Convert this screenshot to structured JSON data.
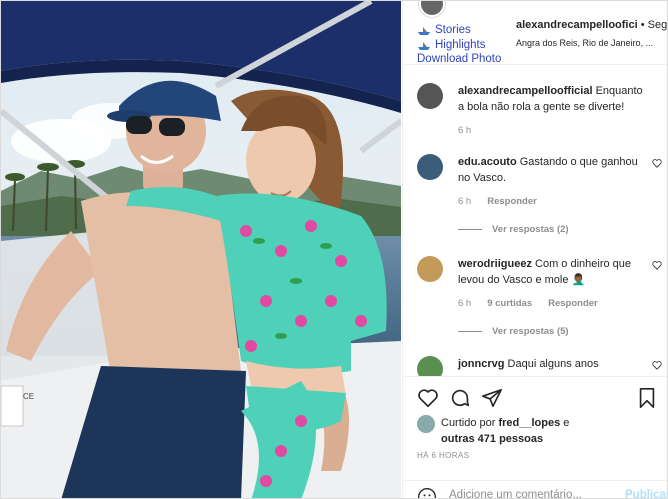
{
  "post": {
    "photo_alt": "",
    "username": "alexandrecampelloofici",
    "follow_sep": " • Seg",
    "location": "Angra dos Reis, Rio de Janeiro, ...",
    "download_links": {
      "stories": "Stories",
      "highlights": "Highlights",
      "download_photo": "Download Photo"
    }
  },
  "comments": [
    {
      "user": "alexandrecampelloofficial",
      "text": "Enquanto a bola não rola a gente se diverte!",
      "time": "6 h",
      "likes": "",
      "reply": "",
      "view_replies": "",
      "avatar_color": "#555555"
    },
    {
      "user": "edu.acouto",
      "text": "Gastando o que ganhou no Vasco.",
      "time": "6 h",
      "likes": "",
      "reply": "Responder",
      "view_replies": "Ver respostas (2)",
      "avatar_color": "#3b5d7a"
    },
    {
      "user": "werodriigueez",
      "text": "Com o dinheiro que levou do Vasco e mole 🤦🏾‍♂️",
      "time": "6 h",
      "likes": "9 curtidas",
      "reply": "Responder",
      "view_replies": "Ver respostas (5)",
      "avatar_color": "#c49a5a"
    },
    {
      "user": "jonncrvg",
      "text": "Daqui alguns anos",
      "time": "",
      "likes": "",
      "reply": "",
      "view_replies": "",
      "avatar_color": "#5b8f52"
    }
  ],
  "liked_by": {
    "prefix": "Curtido por ",
    "user": "fred__lopes",
    "mid": " e",
    "others": "outras 471 pessoas"
  },
  "timestamp": "HÁ 6 HORAS",
  "add_comment": {
    "placeholder": "Adicione um comentário...",
    "publish": "Publicar"
  },
  "icons": [
    "heart-icon",
    "comment-icon",
    "share-icon",
    "bookmark-icon",
    "emoji-icon",
    "boat-icon"
  ],
  "colors": {
    "link": "#3043c0",
    "muted": "#8e8e8e",
    "publish": "#b2dffc"
  }
}
